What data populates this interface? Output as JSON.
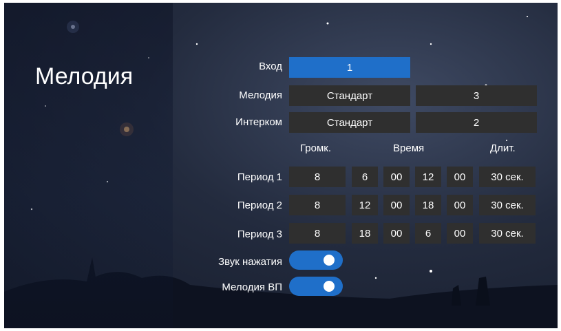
{
  "title": "Мелодия",
  "labels": {
    "input": "Вход",
    "melody": "Мелодия",
    "intercom": "Интерком",
    "period1": "Период 1",
    "period2": "Период 2",
    "period3": "Период 3",
    "key_sound": "Звук нажатия",
    "melody_vp": "Мелодия ВП"
  },
  "values": {
    "input": "1",
    "melody_name": "Стандарт",
    "melody_num": "3",
    "intercom_name": "Стандарт",
    "intercom_num": "2"
  },
  "headers": {
    "volume": "Громк.",
    "time": "Время",
    "duration": "Длит."
  },
  "periods": [
    {
      "volume": "8",
      "start_h": "6",
      "start_m": "00",
      "end_h": "12",
      "end_m": "00",
      "duration": "30 сек."
    },
    {
      "volume": "8",
      "start_h": "12",
      "start_m": "00",
      "end_h": "18",
      "end_m": "00",
      "duration": "30 сек."
    },
    {
      "volume": "8",
      "start_h": "18",
      "start_m": "00",
      "end_h": "6",
      "end_m": "00",
      "duration": "30 сек."
    }
  ],
  "toggles": {
    "key_sound_on": true,
    "melody_vp_on": true
  },
  "colors": {
    "accent": "#1f6fc9",
    "cell": "#2f2f2f"
  }
}
